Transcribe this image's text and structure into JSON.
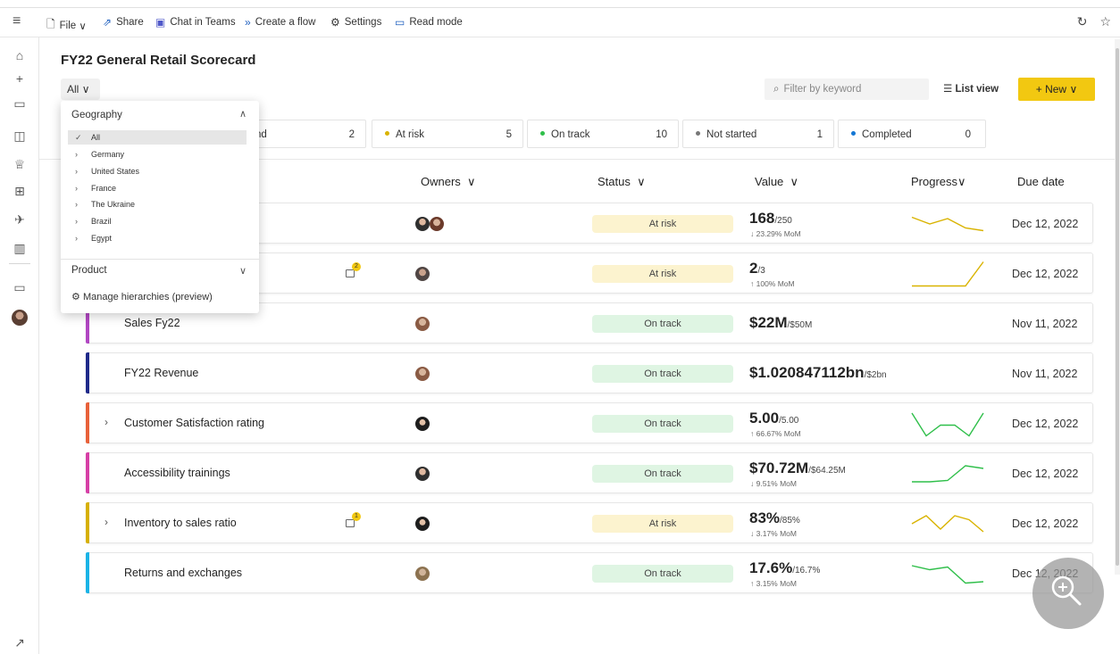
{
  "toolbar": {
    "file": "File",
    "share": "Share",
    "chat": "Chat in Teams",
    "flow": "Create a flow",
    "settings": "Settings",
    "read_mode": "Read mode"
  },
  "header": {
    "title": "FY22 General Retail Scorecard",
    "all_label": "All",
    "filter_placeholder": "Filter by keyword",
    "list_view": "List view",
    "new_label": "New"
  },
  "chips": [
    {
      "label": "nd",
      "count": "2"
    },
    {
      "label": "At risk",
      "count": "5",
      "color": "#d9b300"
    },
    {
      "label": "On track",
      "count": "10",
      "color": "#2fbf4a"
    },
    {
      "label": "Not started",
      "count": "1",
      "color": "#777777"
    },
    {
      "label": "Completed",
      "count": "0",
      "color": "#1477d4"
    }
  ],
  "columns": {
    "owners": "Owners",
    "status": "Status",
    "value": "Value",
    "progress": "Progress",
    "due": "Due date"
  },
  "dropdown": {
    "geography": "Geography",
    "items": [
      "All",
      "Germany",
      "United States",
      "France",
      "The Ukraine",
      "Brazil",
      "Egypt"
    ],
    "product": "Product",
    "manage": "Manage hierarchies (preview)"
  },
  "rows": [
    {
      "name": "",
      "status": "At risk",
      "value": "168",
      "target": "/250",
      "change": "↓ 23.29% MoM",
      "due": "Dec 12, 2022",
      "progress": [
        0.25,
        0.5,
        0.3,
        0.65,
        0.75
      ]
    },
    {
      "name": "",
      "status": "At risk",
      "note": "2",
      "value": "2",
      "target": "/3",
      "change": "↑ 100% MoM",
      "due": "Dec 12, 2022",
      "progress": [
        0.95,
        0.95,
        0.95,
        0.95,
        0.05
      ]
    },
    {
      "name": "Sales Fy22",
      "status": "On track",
      "value": "$22M",
      "target": "/$50M",
      "change": "",
      "due": "Nov 11, 2022"
    },
    {
      "name": "FY22 Revenue",
      "status": "On track",
      "value": "$1.020847112bn",
      "target": "/$2bn",
      "change": "",
      "due": "Nov 11, 2022"
    },
    {
      "name": "Customer Satisfaction rating",
      "status": "On track",
      "value": "5.00",
      "target": "/5.00",
      "change": "↑ 66.67% MoM",
      "due": "Dec 12, 2022",
      "progress": [
        0.1,
        0.95,
        0.55,
        0.55,
        0.95,
        0.1
      ]
    },
    {
      "name": "Accessibility trainings",
      "status": "On track",
      "value": "$70.72M",
      "target": "/$64.25M",
      "change": "↓ 9.51% MoM",
      "due": "Dec 12, 2022",
      "progress": [
        0.8,
        0.8,
        0.75,
        0.2,
        0.3
      ]
    },
    {
      "name": "Inventory to sales ratio",
      "status": "At risk",
      "note": "1",
      "value": "83%",
      "target": "/85%",
      "change": "↓ 3.17% MoM",
      "due": "Dec 12, 2022",
      "progress": [
        0.5,
        0.2,
        0.7,
        0.2,
        0.35,
        0.8
      ]
    },
    {
      "name": "Returns and exchanges",
      "status": "On track",
      "value": "17.6%",
      "target": "/16.7%",
      "change": "↑ 3.15% MoM",
      "due": "Dec 12, 2022",
      "progress": [
        0.2,
        0.35,
        0.25,
        0.85,
        0.8
      ]
    }
  ],
  "colors": {
    "accent": "#f2c811",
    "at_risk": "#fcf3cf",
    "on_track": "#dff5e3",
    "spark_risk": "#d9b300",
    "spark_track": "#2fbf4a",
    "row_bars": [
      "",
      "",
      "#b146c2",
      "#1f2a8a",
      "#e8613a",
      "#d63fa6",
      "#d6b000",
      "#1ab3e6"
    ]
  }
}
